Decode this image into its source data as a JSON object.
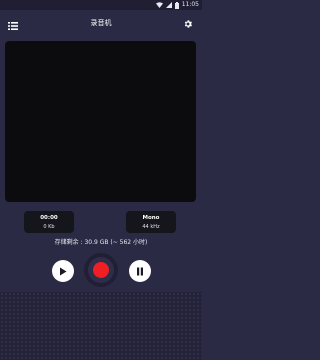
{
  "status_bar": {
    "time": "11:05"
  },
  "app_bar": {
    "title": "录音机",
    "menu_icon": "list-menu-icon",
    "settings_icon": "gear-icon"
  },
  "recording": {
    "elapsed": "00:00",
    "file_size": "0 Kb",
    "channel": "Mono",
    "sample_rate": "44 kHz"
  },
  "storage": {
    "text": "存储剩余 : 30.9 GB (~ 562 小时)"
  },
  "controls": {
    "play_icon": "play-icon",
    "record_icon": "record-icon",
    "pause_icon": "pause-icon",
    "record_color": "#ef1f24"
  },
  "colors": {
    "background": "#2b2a45",
    "panel": "#0c0c0f",
    "card": "#15151c"
  }
}
